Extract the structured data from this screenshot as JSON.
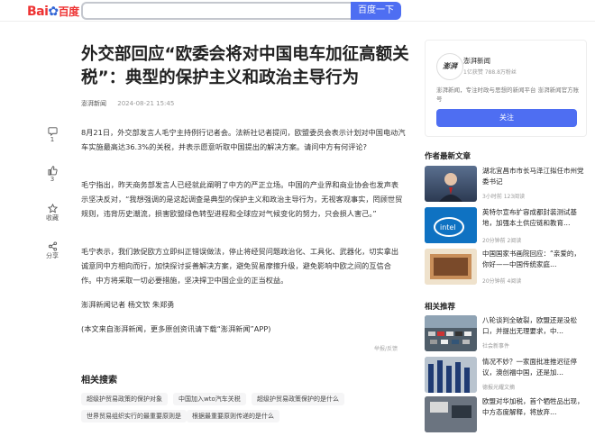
{
  "header": {
    "logo_left": "Bai",
    "logo_right": "百度",
    "search_placeholder": "",
    "search_button": "百度一下"
  },
  "article": {
    "title": "外交部回应“欧委会将对中国电车加征高额关税”：典型的保护主义和政治主导行为",
    "source": "澎湃新闻",
    "date": "2024-08-21 15:45",
    "paragraphs": [
      "8月21日，外交部发言人毛宁主持例行记者会。法新社记者提问，欧盟委员会表示计划对中国电动汽车实施最高达36.3%的关税，并表示愿意听取中国提出的解决方案。请问中方有何评论?",
      "毛宁指出，昨天商务部发言人已经就此阐明了中方的严正立场。中国的产业界和商业协会也发声表示坚决反对，“我想强调的是这起调查是典型的保护主义和政治主导行为，无视客观事实，罔顾世贸规则，违背历史潮流，损害欧盟绿色转型进程和全球应对气候变化的努力，只会损人害己。”",
      "毛宁表示，我们敦促欧方立即纠正错误做法，停止将经贸问题政治化、工具化、武器化，切实拿出诚意同中方相向而行，加快探讨妥善解决方案，避免贸易摩擦升级，避免影响中欧之间的互信合作。中方将采取一切必要措施，坚决捍卫中国企业的正当权益。",
      "澎湃新闻记者 杨文钦 朱郑勇",
      "(本文来自澎湃新闻，更多原创资讯请下载“澎湃新闻”APP)"
    ],
    "feedback": "举报/反馈"
  },
  "leftrail": {
    "comment_count": "1",
    "like_count": "3",
    "collect_label": "收藏",
    "share_label": "分享"
  },
  "related_search": {
    "heading": "相关搜索",
    "tags": [
      "超级护贸易政策的保护对象",
      "中国加入wto汽车关税",
      "超级护贸易政策保护的是什么",
      "世界贸易组织实行的最重要原则是",
      "根据最重要原则传递的是什么"
    ]
  },
  "author": {
    "logo": "澎湃",
    "name": "澎湃新闻",
    "fans": "1亿获赞 788.8万粉丝",
    "desc": "澎湃新闻，专注时政与思想的新闻平台 澎湃新闻官方账号",
    "follow_label": "关注"
  },
  "latest": {
    "heading": "作者最新文章",
    "items": [
      {
        "title": "湖北宜昌市市长马泽江拟任市州党委书记",
        "meta": "3小时前 123阅读"
      },
      {
        "title": "英特尔宣布扩容成都封装测试基地，加强本土供应链和教育…",
        "meta": "20分钟前 2阅读"
      },
      {
        "title": "中国国家书画院回应：“亲爱的，你好——中国传统家庭…",
        "meta": "20分钟前 4阅读"
      }
    ]
  },
  "recommend": {
    "heading": "相关推荐",
    "items": [
      {
        "title": "八轮谈判全破裂，欧盟还是没松口，并提出无理要求，中…",
        "meta": "社会新事件"
      },
      {
        "title": "情况不妙？一家面批准推迟征停议，澳创福中国，还是加…",
        "meta": "德报光耀文摘"
      },
      {
        "title": "欧盟对华加税，首个牺牲品出现，中方态度解释，将放弃…",
        "meta": ""
      }
    ]
  }
}
